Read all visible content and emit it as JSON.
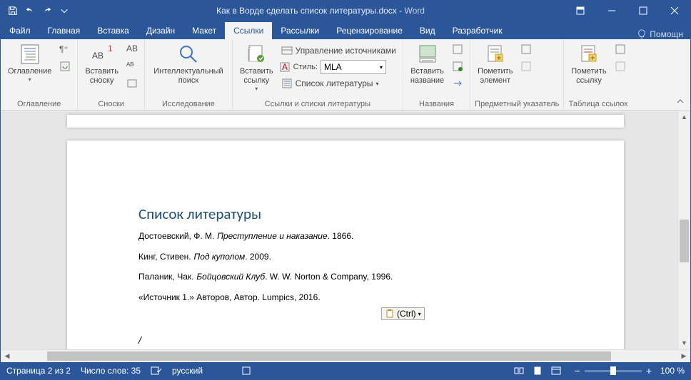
{
  "titlebar": {
    "doc_name": "Как в Ворде сделать список литературы.docx",
    "app_name": "Word"
  },
  "tabs": [
    "Файл",
    "Главная",
    "Вставка",
    "Дизайн",
    "Макет",
    "Ссылки",
    "Рассылки",
    "Рецензирование",
    "Вид",
    "Разработчик"
  ],
  "active_tab": 5,
  "help_label": "Помощн",
  "ribbon": {
    "g_toc": {
      "label": "Оглавление",
      "btn": "Оглавление"
    },
    "g_footnotes": {
      "label": "Сноски",
      "btn": "Вставить\nсноску"
    },
    "g_research": {
      "label": "Исследование",
      "btn": "Интеллектуальный\nпоиск"
    },
    "g_citations": {
      "label": "Ссылки и списки литературы",
      "insert": "Вставить\nссылку",
      "manage": "Управление источниками",
      "style_label": "Стиль:",
      "style_value": "MLA",
      "biblio": "Список литературы"
    },
    "g_captions": {
      "label": "Названия",
      "btn": "Вставить\nназвание"
    },
    "g_index": {
      "label": "Предметный указатель",
      "btn": "Пометить\nэлемент"
    },
    "g_toa": {
      "label": "Таблица ссылок",
      "btn": "Пометить\nссылку"
    }
  },
  "document": {
    "heading": "Список литературы",
    "entries": [
      {
        "author": "Достоевский, Ф. М.",
        "title": "Преступление и наказание",
        "rest": ". 1866."
      },
      {
        "author": "Кинг, Стивен.",
        "title": "Под куполом",
        "rest": ". 2009."
      },
      {
        "author": "Паланик, Чак.",
        "title": "Бойцовский Клуб",
        "rest": ". W. W. Norton & Company, 1996."
      },
      {
        "author": "«Источник 1.» Авторов, Автор. Lumpics, 2016.",
        "title": "",
        "rest": ""
      }
    ],
    "paste_tag": "(Ctrl)",
    "cursor": "/"
  },
  "statusbar": {
    "page": "Страница 2 из 2",
    "words": "Число слов: 35",
    "lang": "русский",
    "zoom": "100 %"
  }
}
